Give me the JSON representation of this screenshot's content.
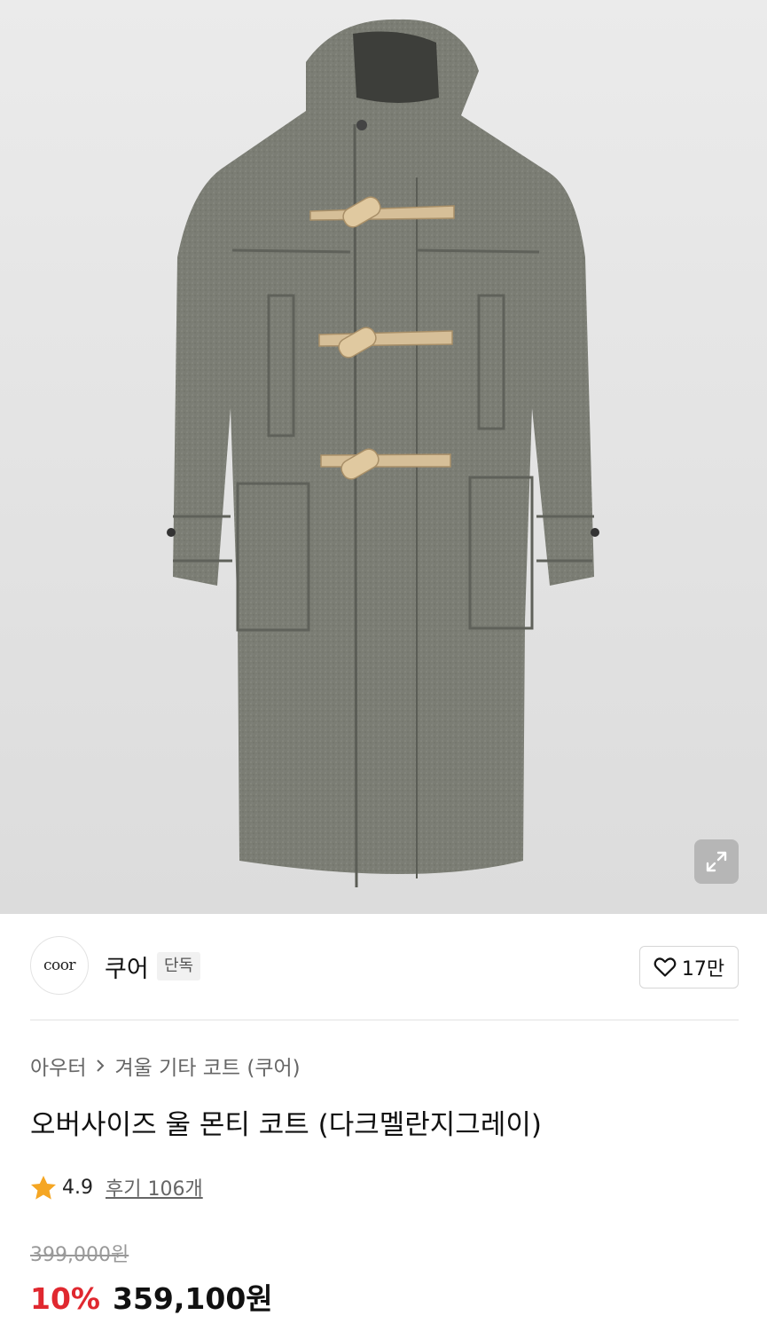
{
  "product_image": {
    "alt": "grey wool duffle coat",
    "background": "#e4e4e4"
  },
  "zoom_icon": "expand-icon",
  "brand": {
    "logo_text": "coor",
    "name": "쿠어",
    "tag": "단독"
  },
  "like": {
    "icon": "heart-icon",
    "count": "17만"
  },
  "breadcrumb": {
    "category": "아우터",
    "subcategory": "겨울 기타 코트 (쿠어)"
  },
  "product": {
    "title": "오버사이즈 울 몬티 코트 (다크멜란지그레이)"
  },
  "rating": {
    "icon": "star-icon",
    "score": "4.9",
    "reviews": "후기 106개",
    "star_color": "#f5a623"
  },
  "price": {
    "original": "399,000원",
    "discount": "10%",
    "sale": "359,100원",
    "discount_color": "#e0282f"
  }
}
